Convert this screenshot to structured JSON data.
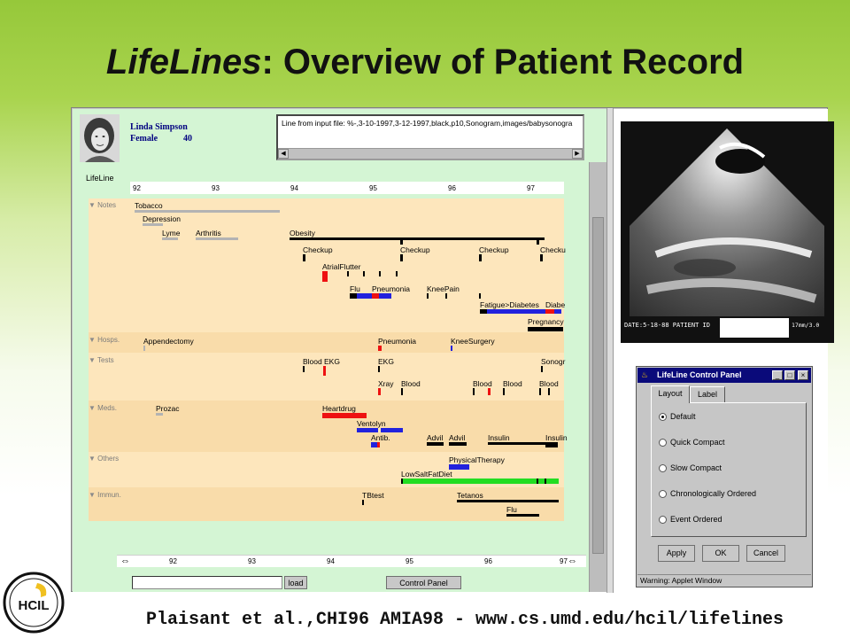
{
  "slide": {
    "title_em": "LifeLines",
    "title_rest": ": Overview of Patient Record",
    "footer": "Plaisant et al.,CHI96 AMIA98 - www.cs.umd.edu/hcil/lifelines",
    "logo_text": "HCIL"
  },
  "patient": {
    "name": "Linda Simpson",
    "sex": "Female",
    "age": "40"
  },
  "input_line": "Line from input file:  %-,3-10-1997,3-12-1997,black,p10,Sonogram,images/babysonogra",
  "lifeline_label": "LifeLine",
  "years_top": [
    "92",
    "93",
    "94",
    "95",
    "96",
    "97"
  ],
  "years_bottom": [
    "92",
    "93",
    "94",
    "95",
    "96",
    "97"
  ],
  "facets": {
    "notes": "Notes",
    "hosps": "Hosps.",
    "tests": "Tests",
    "meds": "Meds.",
    "others": "Others",
    "immun": "Immun."
  },
  "events": {
    "tobacco": "Tobacco",
    "depression": "Depression",
    "lyme": "Lyme",
    "arthritis": "Arthritis",
    "obesity": "Obesity",
    "checkup1": "Checkup",
    "checkup2": "Checkup",
    "checkup3": "Checkup",
    "checkup4": "Checku",
    "atrialflutter": "AtrialFlutter",
    "flu": "Flu",
    "pneumonia": "Pneumonia",
    "kneepain": "KneePain",
    "fatigue": "Fatigue>Diabetes",
    "diabe": "Diabe",
    "pregnancy": "Pregnancy",
    "appendectomy": "Appendectomy",
    "hosp_pneumonia": "Pneumonia",
    "kneesurgery": "KneeSurgery",
    "blood1": "Blood",
    "ekg1": "EKG",
    "ekg2": "EKG",
    "sonogr": "Sonogr",
    "xray": "Xray",
    "blood2": "Blood",
    "blood3": "Blood",
    "blood4": "Blood",
    "blood5": "Blood",
    "prozac": "Prozac",
    "heartdrug": "Heartdrug",
    "ventolyn": "Ventolyn",
    "antib": "Antib.",
    "advil1": "Advil",
    "advil2": "Advil",
    "insulin1": "Insulin",
    "insulin2": "Insulin",
    "physicaltherapy": "PhysicalTherapy",
    "lowsaltfatdiet": "LowSaltFatDiet",
    "tbtest": "TBtest",
    "tetanos": "Tetanos",
    "imm_flu": "Flu"
  },
  "buttons": {
    "load": "load",
    "control_panel": "Control Panel"
  },
  "control_panel": {
    "title": "LifeLine Control Panel",
    "tabs": [
      "Layout",
      "Label"
    ],
    "options": [
      "Default",
      "Quick Compact",
      "Slow Compact",
      "Chronologically Ordered",
      "Event Ordered"
    ],
    "selected": "Default",
    "apply": "Apply",
    "ok": "OK",
    "cancel": "Cancel",
    "status": "Warning: Applet Window"
  },
  "sonogram": {
    "date_text": "DATE:5-18-88  PATIENT ID",
    "scale_text": "17mm/3.0"
  },
  "colors": {
    "grey_bar": "#b3b3b3",
    "black_bar": "#000000",
    "red_bar": "#ee1111",
    "blue_bar": "#2222dd",
    "green_bar": "#22dd22"
  }
}
